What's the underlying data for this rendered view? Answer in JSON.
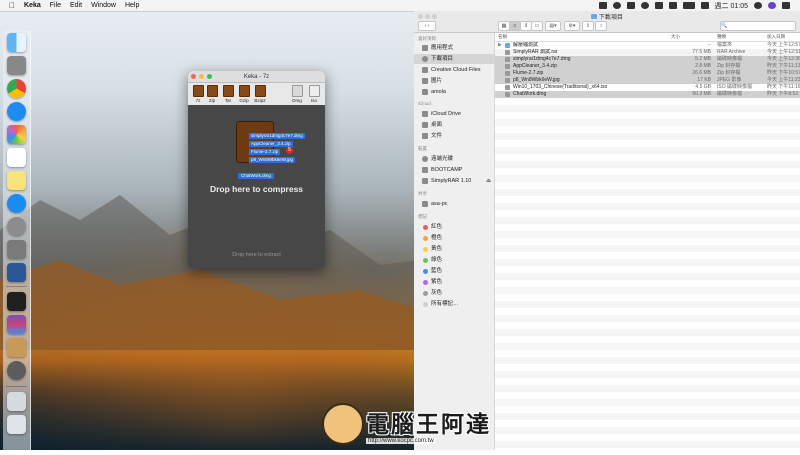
{
  "menubar": {
    "apple": "",
    "app_name": "Keka",
    "items": [
      "File",
      "Edit",
      "Window",
      "Help"
    ],
    "clock": "週二 01:05"
  },
  "keka": {
    "title": "Keka - 7z",
    "formats": [
      "7z",
      "Zip",
      "Tar",
      "Gzip",
      "Bzip2"
    ],
    "extra_tools": [
      "Dmg",
      "Iso"
    ],
    "drag_items": [
      "simplyrar1dmg4c7e7.dmg",
      "AppCleaner_3.4.zip",
      "Flume-2.7.zip",
      "p8_Wn8Wbk6eW.jpg"
    ],
    "drag_badge": "5",
    "chatwork_label": "ChatWork.dmg",
    "drop_compress": "Drop here to compress",
    "drop_extract": "Drop here to extract"
  },
  "finder": {
    "title": "下載項目",
    "sidebar": {
      "favorites_header": "喜好項目",
      "favorites": [
        "應用程式",
        "下載項目",
        "Creative Cloud Files",
        "圖片",
        "amola"
      ],
      "icloud_header": "iCloud",
      "icloud": [
        "iCloud Drive",
        "桌面",
        "文件"
      ],
      "devices_header": "裝置",
      "devices": [
        "遠端光碟",
        "BOOTCAMP",
        "SimplyRAR 1.10"
      ],
      "shared_header": "共享",
      "shared": [
        "asa-pc"
      ],
      "tags_header": "標記",
      "tags": [
        {
          "label": "紅色",
          "color": "#f25b55"
        },
        {
          "label": "橙色",
          "color": "#f5a43a"
        },
        {
          "label": "黃色",
          "color": "#f2d33e"
        },
        {
          "label": "綠色",
          "color": "#5ec84e"
        },
        {
          "label": "藍色",
          "color": "#3d8ff0"
        },
        {
          "label": "紫色",
          "color": "#b26ad8"
        },
        {
          "label": "灰色",
          "color": "#9b9b9b"
        },
        {
          "label": "所有標記…",
          "color": "#cfcfcf"
        }
      ]
    },
    "columns": {
      "name": "名稱",
      "size": "大小",
      "kind": "種類",
      "date": "加入日期"
    },
    "files": [
      {
        "name": "解壓縮測試",
        "size": "--",
        "kind": "檔案夾",
        "date": "今天 上午12:57",
        "folder": true
      },
      {
        "name": "SimplyRAR 測試.rar",
        "size": "77.5 MB",
        "kind": "RAR Archive",
        "date": "今天 上午12:51"
      },
      {
        "name": "simplyrar1dmg4c7e7.dmg",
        "size": "5.2 MB",
        "kind": "磁碟映像檔",
        "date": "今天 上午12:36"
      },
      {
        "name": "AppCleaner_3.4.zip",
        "size": "2.8 MB",
        "kind": "Zip 封存檔",
        "date": "昨天 下午11:13"
      },
      {
        "name": "Flume-2.7.zip",
        "size": "26.6 MB",
        "kind": "Zip 封存檔",
        "date": "昨天 下午10:57"
      },
      {
        "name": "p8_Wn8Wbk6eW.jpg",
        "size": "17 KB",
        "kind": "JPEG 影像",
        "date": "今天 上午11:23"
      },
      {
        "name": "Win10_1703_Chinese(Traditional)_x64.iso",
        "size": "4.5 GB",
        "kind": "ISO 磁碟映像檔",
        "date": "昨天 下午11:16"
      },
      {
        "name": "ChatWork.dmg",
        "size": "50.3 MB",
        "kind": "磁碟映像檔",
        "date": "昨天 下午8:52"
      }
    ]
  },
  "watermark": {
    "text": "電腦王阿達",
    "url": "http://www.kocpc.com.tw"
  },
  "colors": {
    "selection_blue": "#2f6fd6",
    "keka_dark": "#474747",
    "close": "#fc5f57",
    "minimize": "#fdbb2e",
    "zoom": "#2ac940"
  }
}
